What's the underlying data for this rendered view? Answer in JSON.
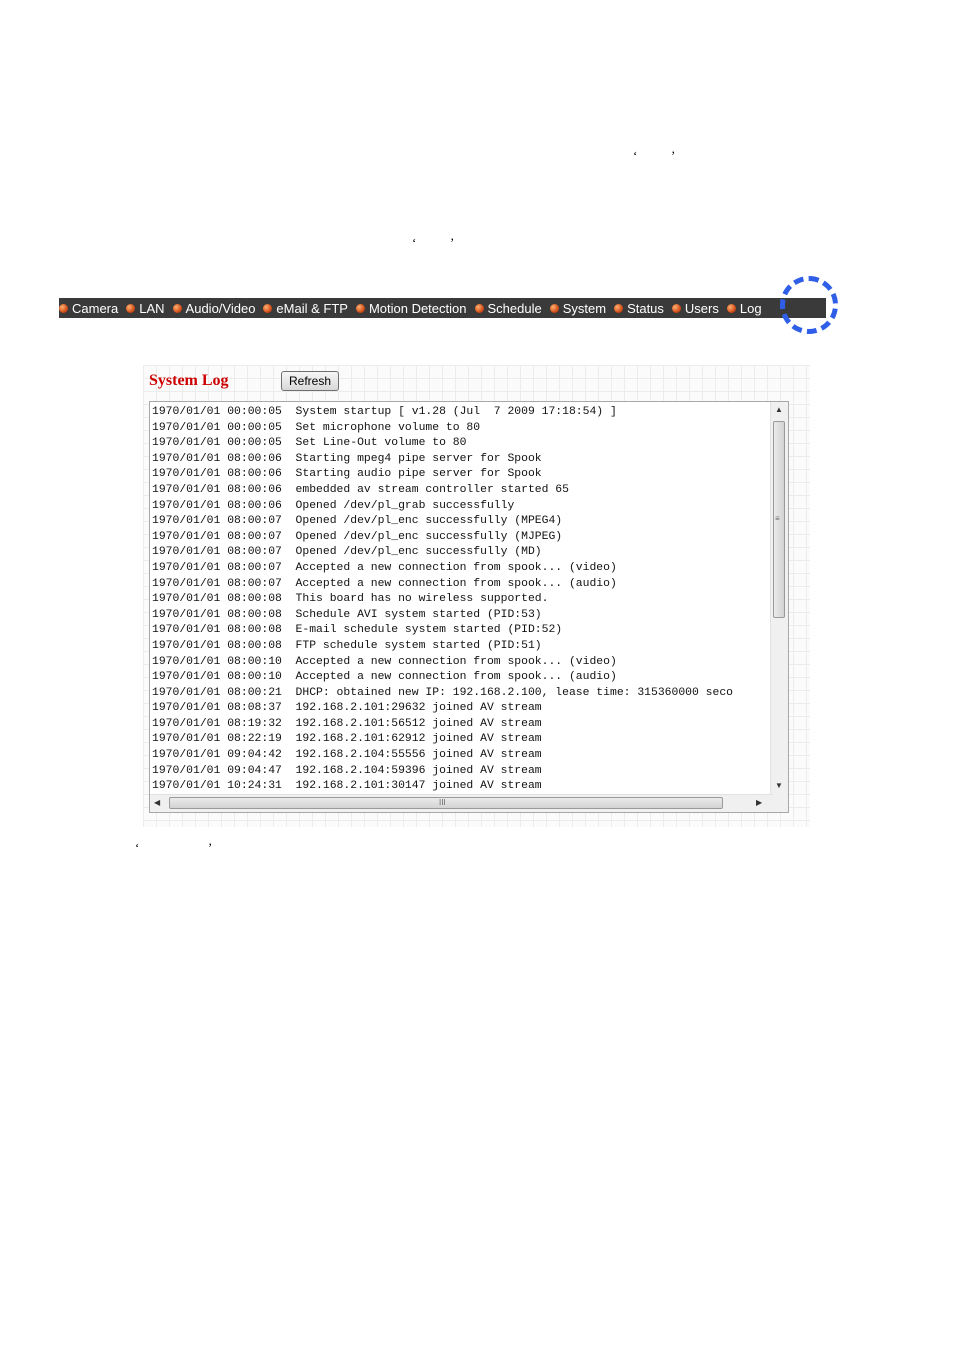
{
  "quotes": {
    "q1_open": "‘",
    "q1_close": "’",
    "q2_open": "‘",
    "q2_close": "’",
    "q3_open": "‘",
    "q3_close": "’"
  },
  "nav": {
    "items": [
      {
        "label": "Camera"
      },
      {
        "label": "LAN"
      },
      {
        "label": "Audio/Video"
      },
      {
        "label": "eMail & FTP"
      },
      {
        "label": "Motion Detection"
      },
      {
        "label": "Schedule"
      },
      {
        "label": "System"
      },
      {
        "label": "Status"
      },
      {
        "label": "Users"
      },
      {
        "label": "Log"
      }
    ],
    "highlight_color": "#2f5fe8"
  },
  "panel": {
    "title": "System Log",
    "refresh_label": "Refresh",
    "log_lines": [
      "1970/01/01 00:00:05  System startup [ v1.28 (Jul  7 2009 17:18:54) ]",
      "1970/01/01 00:00:05  Set microphone volume to 80",
      "1970/01/01 00:00:05  Set Line-Out volume to 80",
      "1970/01/01 08:00:06  Starting mpeg4 pipe server for Spook",
      "1970/01/01 08:00:06  Starting audio pipe server for Spook",
      "1970/01/01 08:00:06  embedded av stream controller started 65",
      "1970/01/01 08:00:06  Opened /dev/pl_grab successfully",
      "1970/01/01 08:00:07  Opened /dev/pl_enc successfully (MPEG4)",
      "1970/01/01 08:00:07  Opened /dev/pl_enc successfully (MJPEG)",
      "1970/01/01 08:00:07  Opened /dev/pl_enc successfully (MD)",
      "1970/01/01 08:00:07  Accepted a new connection from spook... (video)",
      "1970/01/01 08:00:07  Accepted a new connection from spook... (audio)",
      "1970/01/01 08:00:08  This board has no wireless supported.",
      "1970/01/01 08:00:08  Schedule AVI system started (PID:53)",
      "1970/01/01 08:00:08  E-mail schedule system started (PID:52)",
      "1970/01/01 08:00:08  FTP schedule system started (PID:51)",
      "1970/01/01 08:00:10  Accepted a new connection from spook... (video)",
      "1970/01/01 08:00:10  Accepted a new connection from spook... (audio)",
      "1970/01/01 08:00:21  DHCP: obtained new IP: 192.168.2.100, lease time: 315360000 seco",
      "1970/01/01 08:08:37  192.168.2.101:29632 joined AV stream",
      "1970/01/01 08:19:32  192.168.2.101:56512 joined AV stream",
      "1970/01/01 08:22:19  192.168.2.101:62912 joined AV stream",
      "1970/01/01 09:04:42  192.168.2.104:55556 joined AV stream",
      "1970/01/01 09:04:47  192.168.2.104:59396 joined AV stream",
      "1970/01/01 10:24:31  192.168.2.101:30147 joined AV stream"
    ],
    "title_color": "#cc0000",
    "scroll_up_icon": "▲",
    "scroll_down_icon": "▼",
    "scroll_left_icon": "◀",
    "scroll_right_icon": "▶",
    "vgrip": "≡",
    "hgrip": "III"
  }
}
